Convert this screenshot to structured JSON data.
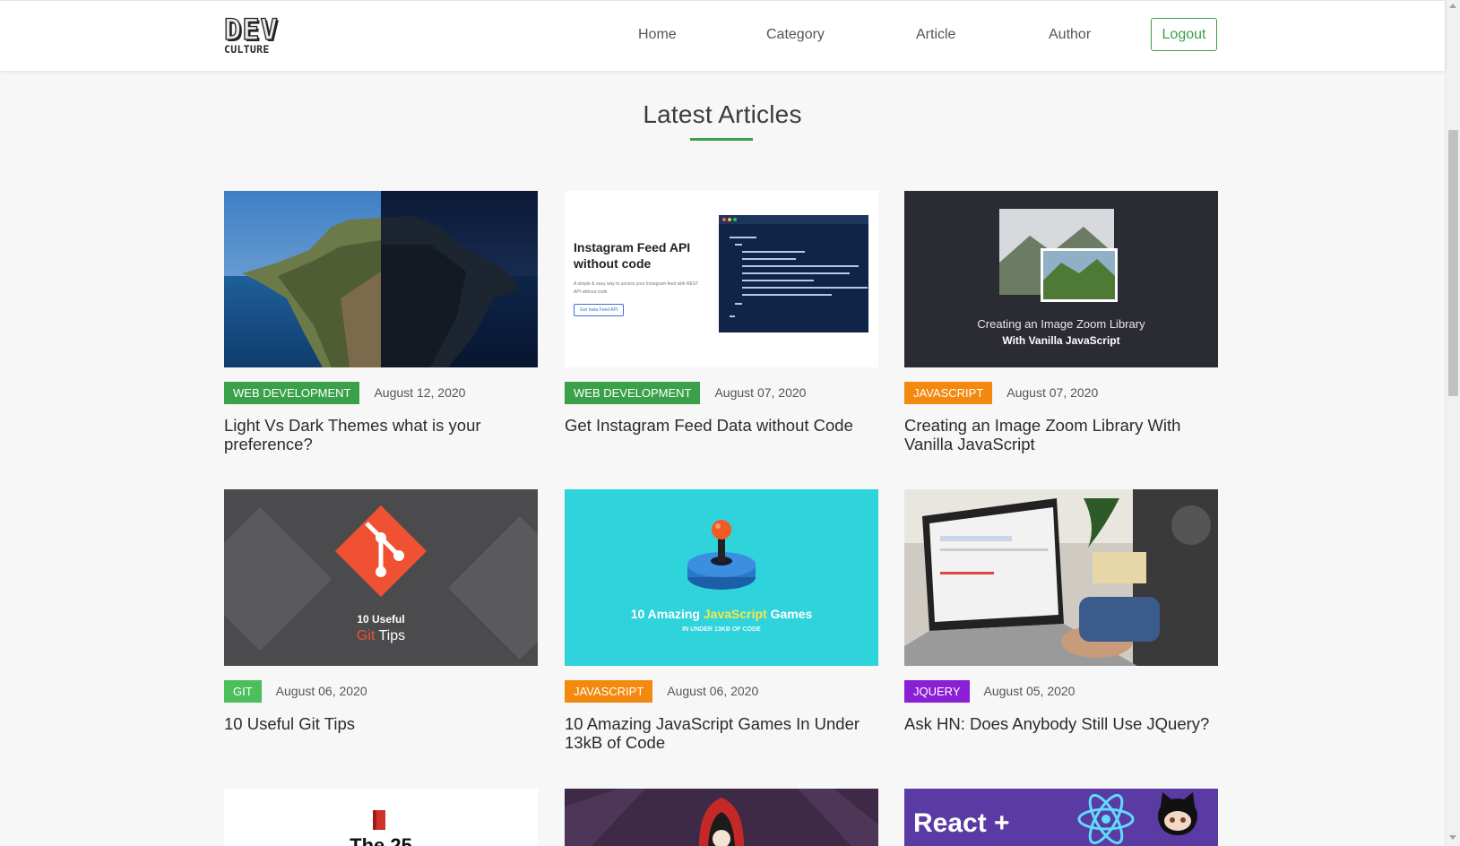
{
  "navbar": {
    "logo_line1": "DEV",
    "logo_line2": "CULTURE",
    "links": [
      "Home",
      "Category",
      "Article",
      "Author"
    ],
    "logout_label": "Logout"
  },
  "section_title": "Latest Articles",
  "articles": [
    {
      "category": "WEB DEVELOPMENT",
      "category_color": "#3aa14a",
      "date": "August 12, 2020",
      "title": "Light Vs Dark Themes what is your preference?",
      "image": "macOS Catalina island wallpaper, light and dark halves"
    },
    {
      "category": "WEB DEVELOPMENT",
      "category_color": "#3aa14a",
      "date": "August 07, 2020",
      "title": "Get Instagram Feed Data without Code",
      "image": "Instagram Feed API without code",
      "image_text": {
        "heading_line1": "Instagram Feed API",
        "heading_line2": "without code",
        "subtext_line1": "A simple & easy way to access your Instagram feed with REST",
        "subtext_line2": "API without code.",
        "button": "Get Insta Feed API"
      }
    },
    {
      "category": "JAVASCRIPT",
      "category_color": "#f3890f",
      "date": "August 07, 2020",
      "title": "Creating an Image Zoom Library With Vanilla JavaScript",
      "image": "Creating an Image Zoom Library With Vanilla JavaScript",
      "image_text": {
        "line1": "Creating an Image Zoom Library",
        "line2": "With Vanilla JavaScript"
      }
    },
    {
      "category": "GIT",
      "category_color": "#4cbf5c",
      "date": "August 06, 2020",
      "title": "10 Useful Git Tips",
      "image": "10 Useful Git Tips",
      "image_text": {
        "line1": "10 Useful",
        "line2_accent": "Git",
        "line2_rest": "Tips"
      }
    },
    {
      "category": "JAVASCRIPT",
      "category_color": "#f3890f",
      "date": "August 06, 2020",
      "title": "10 Amazing JavaScript Games In Under 13kB of Code",
      "image": "10 Amazing JavaScript Games",
      "image_text": {
        "before": "10 Amazing",
        "accent": "JavaScript",
        "after": "Games",
        "sub": "IN UNDER 13KB OF CODE"
      }
    },
    {
      "category": "JQUERY",
      "category_color": "#8a1fd6",
      "date": "August 05, 2020",
      "title": "Ask HN: Does Anybody Still Use JQuery?",
      "image": "person typing on a laptop"
    }
  ],
  "partial_row": [
    {
      "image": "book icon",
      "image_text": "The 25"
    },
    {
      "image": "hooded character"
    },
    {
      "image": "React + GitHub",
      "image_text": "React +"
    }
  ]
}
